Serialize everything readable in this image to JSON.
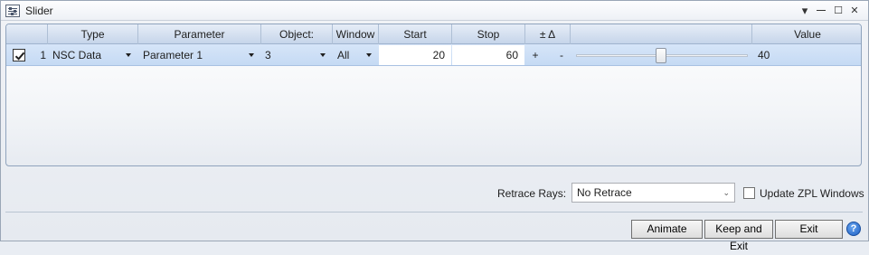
{
  "window": {
    "title": "Slider",
    "controls": {
      "menu": "▾",
      "minimize": "—",
      "maximize": "☐",
      "close": "✕"
    }
  },
  "grid": {
    "columns": [
      "Type",
      "Parameter",
      "Object:",
      "Window",
      "Start",
      "Stop",
      "± Δ",
      "",
      "Value"
    ],
    "rows": [
      {
        "checked": true,
        "index": "1",
        "type": "NSC Data",
        "parameter": "Parameter 1",
        "object": "3",
        "window": "All",
        "start": "20",
        "stop": "60",
        "plus": "+",
        "minus": "-",
        "slider_fraction": 0.5,
        "value": "40"
      }
    ]
  },
  "footer": {
    "retrace_label": "Retrace Rays:",
    "retrace_value": "No Retrace",
    "update_label": "Update ZPL Windows",
    "update_checked": false,
    "animate_label": "Animate",
    "keep_exit_label": "Keep and Exit",
    "exit_label": "Exit",
    "help_label": "?"
  },
  "colors": {
    "row_selected": "#c5daf4",
    "header": "#c6d5ea",
    "help": "#1d5fc4"
  }
}
